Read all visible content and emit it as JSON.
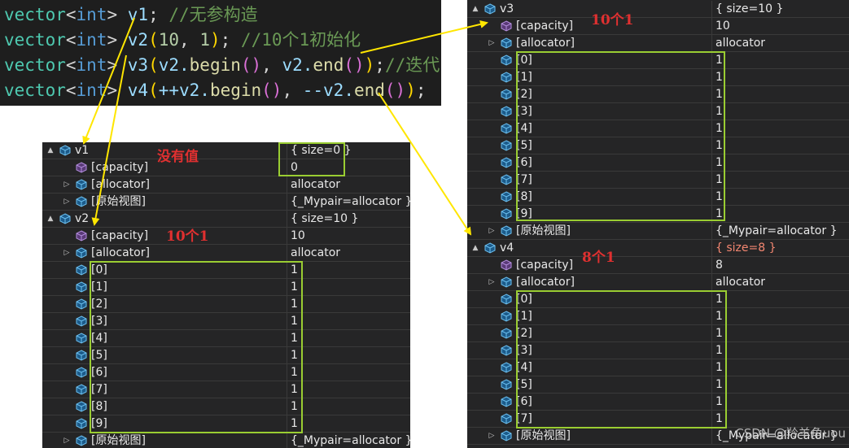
{
  "code": {
    "lines": [
      {
        "type": "vector",
        "lt": "<",
        "tp": "int",
        "gt": ">",
        "var": "v1",
        "rest": ";",
        "comment": " //无参构造"
      },
      {
        "type": "vector",
        "lt": "<",
        "tp": "int",
        "gt": ">",
        "var": "v2",
        "open": "(",
        "n1": "10",
        "sep": ", ",
        "n2": "1",
        "close": ")",
        "rest": ";",
        "comment": " //10个1初始化"
      },
      {
        "type": "vector",
        "lt": "<",
        "tp": "int",
        "gt": ">",
        "var": "v3",
        "open": "(",
        "a": "v2.",
        "f1": "begin",
        "p1": "()",
        "sep": ", ",
        "b": "v2.",
        "f2": "end",
        "p2": "()",
        "close": ")",
        "rest": ";",
        "comment": "//迭代"
      },
      {
        "type": "vector",
        "lt": "<",
        "tp": "int",
        "gt": ">",
        "var": "v4",
        "open": "(",
        "a": "++v2.",
        "f1": "begin",
        "p1": "()",
        "sep": ", ",
        "b": "--v2.",
        "f2": "end",
        "p2": "()",
        "close": ")",
        "rest": ";",
        "comment": ""
      }
    ]
  },
  "annotations": {
    "v1": "没有值",
    "v2": "10个1",
    "v3": "10个1",
    "v4": "8个1"
  },
  "watch_left": {
    "rows": [
      {
        "name": "v1",
        "value": "{ size=0 }",
        "expander": "▲",
        "level": 0,
        "icon": "cube-icon"
      },
      {
        "name": "[capacity]",
        "value": "0",
        "expander": "",
        "level": 1,
        "icon": "property-icon"
      },
      {
        "name": "[allocator]",
        "value": "allocator",
        "expander": "▷",
        "level": 1,
        "icon": "cube-icon"
      },
      {
        "name": "[原始视图]",
        "value": "{_Mypair=allocator }",
        "expander": "▷",
        "level": 1,
        "icon": "cube-icon"
      },
      {
        "name": "v2",
        "value": "{ size=10 }",
        "expander": "▲",
        "level": 0,
        "icon": "cube-icon"
      },
      {
        "name": "[capacity]",
        "value": "10",
        "expander": "",
        "level": 1,
        "icon": "property-icon"
      },
      {
        "name": "[allocator]",
        "value": "allocator",
        "expander": "▷",
        "level": 1,
        "icon": "cube-icon"
      },
      {
        "name": "[0]",
        "value": "1",
        "expander": "",
        "level": 1,
        "icon": "cube-icon"
      },
      {
        "name": "[1]",
        "value": "1",
        "expander": "",
        "level": 1,
        "icon": "cube-icon"
      },
      {
        "name": "[2]",
        "value": "1",
        "expander": "",
        "level": 1,
        "icon": "cube-icon"
      },
      {
        "name": "[3]",
        "value": "1",
        "expander": "",
        "level": 1,
        "icon": "cube-icon"
      },
      {
        "name": "[4]",
        "value": "1",
        "expander": "",
        "level": 1,
        "icon": "cube-icon"
      },
      {
        "name": "[5]",
        "value": "1",
        "expander": "",
        "level": 1,
        "icon": "cube-icon"
      },
      {
        "name": "[6]",
        "value": "1",
        "expander": "",
        "level": 1,
        "icon": "cube-icon"
      },
      {
        "name": "[7]",
        "value": "1",
        "expander": "",
        "level": 1,
        "icon": "cube-icon"
      },
      {
        "name": "[8]",
        "value": "1",
        "expander": "",
        "level": 1,
        "icon": "cube-icon"
      },
      {
        "name": "[9]",
        "value": "1",
        "expander": "",
        "level": 1,
        "icon": "cube-icon"
      },
      {
        "name": "[原始视图]",
        "value": "{_Mypair=allocator }",
        "expander": "▷",
        "level": 1,
        "icon": "cube-icon"
      }
    ]
  },
  "watch_right": {
    "rows": [
      {
        "name": "v3",
        "value": "{ size=10 }",
        "expander": "▲",
        "level": 0,
        "icon": "cube-icon"
      },
      {
        "name": "[capacity]",
        "value": "10",
        "expander": "",
        "level": 1,
        "icon": "property-icon"
      },
      {
        "name": "[allocator]",
        "value": "allocator",
        "expander": "▷",
        "level": 1,
        "icon": "cube-icon"
      },
      {
        "name": "[0]",
        "value": "1",
        "expander": "",
        "level": 1,
        "icon": "cube-icon"
      },
      {
        "name": "[1]",
        "value": "1",
        "expander": "",
        "level": 1,
        "icon": "cube-icon"
      },
      {
        "name": "[2]",
        "value": "1",
        "expander": "",
        "level": 1,
        "icon": "cube-icon"
      },
      {
        "name": "[3]",
        "value": "1",
        "expander": "",
        "level": 1,
        "icon": "cube-icon"
      },
      {
        "name": "[4]",
        "value": "1",
        "expander": "",
        "level": 1,
        "icon": "cube-icon"
      },
      {
        "name": "[5]",
        "value": "1",
        "expander": "",
        "level": 1,
        "icon": "cube-icon"
      },
      {
        "name": "[6]",
        "value": "1",
        "expander": "",
        "level": 1,
        "icon": "cube-icon"
      },
      {
        "name": "[7]",
        "value": "1",
        "expander": "",
        "level": 1,
        "icon": "cube-icon"
      },
      {
        "name": "[8]",
        "value": "1",
        "expander": "",
        "level": 1,
        "icon": "cube-icon"
      },
      {
        "name": "[9]",
        "value": "1",
        "expander": "",
        "level": 1,
        "icon": "cube-icon"
      },
      {
        "name": "[原始视图]",
        "value": "{_Mypair=allocator }",
        "expander": "▷",
        "level": 1,
        "icon": "cube-icon"
      },
      {
        "name": "v4",
        "value": "{ size=8 }",
        "expander": "▲",
        "level": 0,
        "icon": "cube-icon",
        "highlight": true
      },
      {
        "name": "[capacity]",
        "value": "8",
        "expander": "",
        "level": 1,
        "icon": "property-icon"
      },
      {
        "name": "[allocator]",
        "value": "allocator",
        "expander": "▷",
        "level": 1,
        "icon": "cube-icon"
      },
      {
        "name": "[0]",
        "value": "1",
        "expander": "",
        "level": 1,
        "icon": "cube-icon"
      },
      {
        "name": "[1]",
        "value": "1",
        "expander": "",
        "level": 1,
        "icon": "cube-icon"
      },
      {
        "name": "[2]",
        "value": "1",
        "expander": "",
        "level": 1,
        "icon": "cube-icon"
      },
      {
        "name": "[3]",
        "value": "1",
        "expander": "",
        "level": 1,
        "icon": "cube-icon"
      },
      {
        "name": "[4]",
        "value": "1",
        "expander": "",
        "level": 1,
        "icon": "cube-icon"
      },
      {
        "name": "[5]",
        "value": "1",
        "expander": "",
        "level": 1,
        "icon": "cube-icon"
      },
      {
        "name": "[6]",
        "value": "1",
        "expander": "",
        "level": 1,
        "icon": "cube-icon"
      },
      {
        "name": "[7]",
        "value": "1",
        "expander": "",
        "level": 1,
        "icon": "cube-icon"
      },
      {
        "name": "[原始视图]",
        "value": "{_Mypair=allocator }",
        "expander": "▷",
        "level": 1,
        "icon": "cube-icon"
      }
    ]
  },
  "watermark": "CSDN @羚羊角uou",
  "colors": {
    "panel_bg": "#252526",
    "code_bg": "#1e1e1e",
    "highlight_box": "#9acd32",
    "annotation": "#e03030",
    "arrow": "#ffe600"
  }
}
